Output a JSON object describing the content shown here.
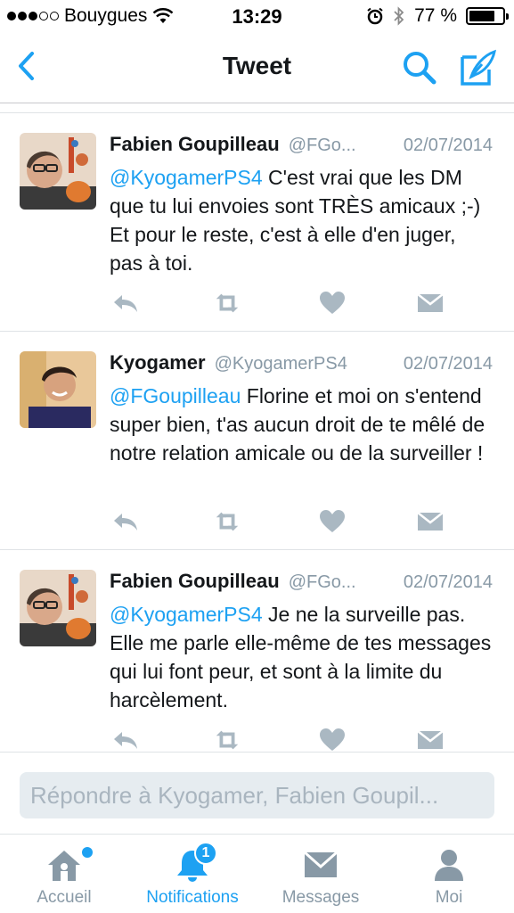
{
  "status_bar": {
    "carrier": "Bouygues",
    "time": "13:29",
    "battery_percent": "77 %",
    "battery_level": 0.77,
    "signal_bars": 3
  },
  "nav": {
    "title": "Tweet",
    "icons": [
      "back-chevron-icon",
      "search-icon",
      "compose-icon"
    ],
    "accent_color": "#1da1f2"
  },
  "tweets": [
    {
      "name": "Fabien Goupilleau",
      "handle": "@FGo...",
      "date": "02/07/2014",
      "mention": "@KyogamerPS4",
      "text": " C'est vrai que les DM que tu lui envoies sont TRÈS amicaux ;-) Et pour le reste, c'est à elle d'en juger, pas à toi."
    },
    {
      "name": "Kyogamer",
      "handle": "@KyogamerPS4",
      "date": "02/07/2014",
      "mention": "@FGoupilleau",
      "text": " Florine et moi on s'entend super bien, t'as aucun droit de te mêlé de notre relation amicale ou de la surveiller !"
    },
    {
      "name": "Fabien Goupilleau",
      "handle": "@FGo...",
      "date": "02/07/2014",
      "mention": "@KyogamerPS4",
      "text": " Je ne la surveille pas. Elle me parle elle-même de tes messages qui lui font peur, et sont à la limite du harcèlement."
    }
  ],
  "actions": [
    "reply-icon",
    "retweet-icon",
    "like-icon",
    "direct-message-icon"
  ],
  "reply": {
    "placeholder": "Répondre à Kyogamer, Fabien Goupil..."
  },
  "tabs": [
    {
      "label": "Accueil",
      "icon": "home-icon",
      "active": false,
      "dot": true
    },
    {
      "label": "Notifications",
      "icon": "bell-icon",
      "active": true,
      "badge": "1"
    },
    {
      "label": "Messages",
      "icon": "envelope-icon",
      "active": false
    },
    {
      "label": "Moi",
      "icon": "person-icon",
      "active": false
    }
  ]
}
